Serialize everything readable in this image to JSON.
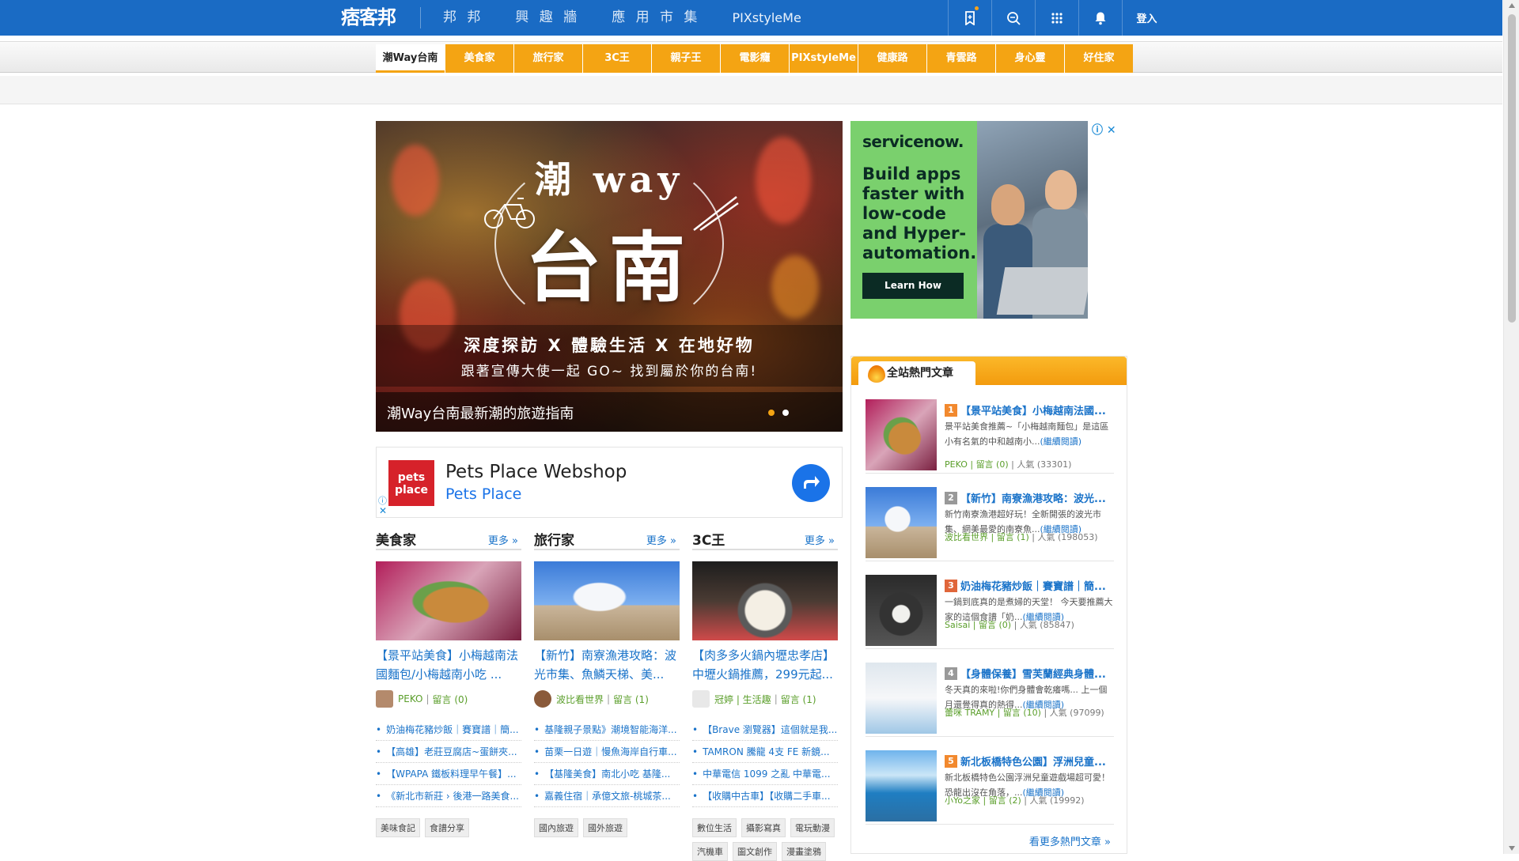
{
  "header": {
    "logo": "痞客邦",
    "nav": [
      "邦 邦",
      "興 趣 牆",
      "應 用 市 集",
      "PIXstyleMe"
    ],
    "icons": [
      "bookmark-icon",
      "search-icon",
      "grid-icon",
      "bell-icon"
    ],
    "login": "登入",
    "brand_color": "#1a6bc4"
  },
  "channels": {
    "items": [
      "潮Way台南",
      "美食家",
      "旅行家",
      "3C王",
      "親子王",
      "電影癮",
      "PIXstyleMe",
      "健康路",
      "青雲路",
      "身心靈",
      "好住家"
    ],
    "active": "潮Way台南",
    "accent": "#f4a413"
  },
  "hero": {
    "title_top": "潮 way",
    "title_main": "台南",
    "tagline": "深度探訪 X 體驗生活 X 在地好物",
    "subtagline": "跟著宣傳大使一起 GO~ 找到屬於你的台南!",
    "caption": "潮Way台南最新潮的旅遊指南"
  },
  "ad_right": {
    "brand": "servicenow.",
    "headline": "Build apps faster with low-code and Hyper-automation.",
    "button": "Learn How"
  },
  "ad_pets": {
    "logo": "pets place",
    "title": "Pets Place Webshop",
    "subtitle": "Pets Place"
  },
  "columns": [
    {
      "title": "美食家",
      "more": "更多 »",
      "article": "【景平站美食】小梅越南法國麵包/小梅越南小吃 ...",
      "author": "PEKO",
      "comments": "留言 (0)",
      "list": [
        "奶油梅花豬炒飯｜賽寶譜｜簡...",
        "【高雄】老莊豆腐店~蛋餅夾...",
        "【WPAPA 鐵板料理早午餐】...",
        "《新北市新莊 › 後港一路美食..."
      ],
      "tags": [
        "美味食記",
        "食譜分享"
      ]
    },
    {
      "title": "旅行家",
      "more": "更多 »",
      "article": "【新竹】南寮漁港攻略：波光市集、魚鱗天梯、美...",
      "author": "波比看世界",
      "comments": "留言 (1)",
      "list": [
        "基隆親子景點》潮境智能海洋...",
        "苗栗一日遊｜慢魚海岸自行車...",
        "【基隆美食】南北小吃 基隆...",
        "嘉義住宿｜承億文旅-桃城茶..."
      ],
      "tags": [
        "國內旅遊",
        "國外旅遊"
      ]
    },
    {
      "title": "3C王",
      "more": "更多 »",
      "article": "【肉多多火鍋內壢忠孝店】中壢火鍋推薦，299元起...",
      "author": "冠婷 | 生活趣",
      "comments": "留言 (1)",
      "list": [
        "【Brave 瀏覽器】這個就是我...",
        "TAMRON 騰龍 4支 FE 新鏡...",
        "中華電信 1099 之亂 中華電...",
        "【收購中古車】【收購二手車..."
      ],
      "tags": [
        "數位生活",
        "攝影寫真",
        "電玩動漫",
        "汽機車",
        "圖文創作",
        "漫畫塗鴉"
      ]
    }
  ],
  "hot": {
    "title": "全站熱門文章",
    "items": [
      {
        "rank": "1",
        "title": "【景平站美食】小梅越南法國...",
        "desc": "景平站美食推薦~「小梅越南麵包」是這區小有名氣的中和越南小...",
        "readmore": "(繼續閱讀)",
        "author": "PEKO",
        "comments": "留言 (0)",
        "popularity": "人氣 (33301)",
        "rank_color": "#f2892e"
      },
      {
        "rank": "2",
        "title": "【新竹】南寮漁港攻略：波光...",
        "desc": "新竹南寮漁港超好玩！全新開張的波光市集、網美最愛的南寮魚...",
        "readmore": "(繼續閱讀)",
        "author": "波比看世界",
        "comments": "留言 (1)",
        "popularity": "人氣 (198053)",
        "rank_color": "#999999"
      },
      {
        "rank": "3",
        "title": "奶油梅花豬炒飯｜賽寶譜｜簡...",
        "desc": "一鍋到底真的是煮婦的天堂！ 今天要推薦大家的這個食譜「奶...",
        "readmore": "(繼續閱讀)",
        "author": "Saisai",
        "comments": "留言 (0)",
        "popularity": "人氣 (85847)",
        "rank_color": "#e0663a"
      },
      {
        "rank": "4",
        "title": "【身體保養】雪芙蘭經典身體...",
        "desc": "冬天真的來啦!你們身體會乾癢嗎... 上一個月還覺得真的熱得...",
        "readmore": "(繼續閱讀)",
        "author": "蕾咪 TRAMY",
        "comments": "留言 (10)",
        "popularity": "人氣 (97099)",
        "rank_color": "#999999"
      },
      {
        "rank": "5",
        "title": "新北板橋特色公園】浮洲兒童...",
        "desc": "新北板橋特色公園浮洲兒童遊戲場超可愛！恐龍出沒在角落，...",
        "readmore": "(繼續閱讀)",
        "author": "小Yo之家",
        "comments": "留言 (2)",
        "popularity": "人氣 (19992)",
        "rank_color": "#f2892e"
      }
    ],
    "more": "看更多熱門文章 »"
  }
}
